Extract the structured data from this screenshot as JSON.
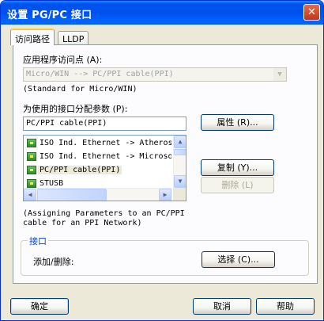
{
  "window": {
    "title": "设置 PG/PC 接口",
    "close_glyph": "✕"
  },
  "tabs": [
    {
      "label": "访问路径",
      "active": true
    },
    {
      "label": "LLDP",
      "active": false
    }
  ],
  "access_point": {
    "label": "应用程序访问点 (A):",
    "value": "Micro/WIN       --> PC/PPI cable(PPI)",
    "description": "(Standard for Micro/WIN)"
  },
  "interface_params": {
    "label": "为使用的接口分配参数 (P):",
    "value": "PC/PPI cable(PPI)"
  },
  "interface_list": [
    {
      "label": "ISO Ind. Ethernet -> Atheros",
      "selected": false
    },
    {
      "label": "ISO Ind. Ethernet -> Microsoft",
      "selected": false
    },
    {
      "label": "PC/PPI cable(PPI)",
      "selected": true
    },
    {
      "label": "STUSB",
      "selected": false
    }
  ],
  "list_description_line1": "(Assigning Parameters to an PC/PPI",
  "list_description_line2": "cable for an PPI Network)",
  "buttons": {
    "properties": "属性 (R)...",
    "copy": "复制 (Y)...",
    "delete": "删除 (L)",
    "select": "选择 (C)...",
    "ok": "确定",
    "cancel": "取消",
    "help": "帮助"
  },
  "interface_group": {
    "title": "接口",
    "add_remove_label": "添加/删除:"
  },
  "icons": {
    "combo_arrow": "▼",
    "scroll_up": "▲",
    "scroll_down": "▼",
    "scroll_left": "◀",
    "scroll_right": "▶"
  },
  "colors": {
    "titlebar": "#0053ee",
    "dialog_bg": "#ece9d8",
    "panel_bg": "#fcfcfe",
    "group_title": "#0046d5",
    "disabled_text": "#aca899"
  }
}
